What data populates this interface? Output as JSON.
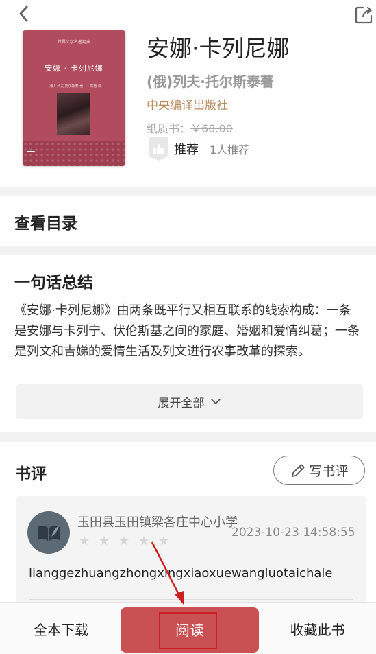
{
  "icons": {
    "back": "chevron-left-icon",
    "share": "share-icon",
    "recommend": "thumbs-up-icon",
    "expand": "chevron-down-icon",
    "write": "pencil-icon",
    "avatar": "book-leaf-icon"
  },
  "colors": {
    "accent": "#c95153",
    "publisher": "#b98c5f",
    "cover": "#b04c5d",
    "annotation": "#cc1f1f"
  },
  "book": {
    "cover": {
      "series": "世界文学名著经典",
      "title": "安娜 · 卡列尼娜",
      "author_line": "〔俄〕列夫·托尔斯泰 著　　高植 译"
    },
    "title": "安娜·卡列尼娜",
    "author": "(俄)列夫·托尔斯泰著",
    "publisher": "中央编译出版社",
    "price_label": "纸质书：",
    "price_value": "￥68.00",
    "recommend_label": "推荐",
    "recommend_count": "1人推荐"
  },
  "catalog": {
    "label": "查看目录"
  },
  "summary": {
    "title": "一句话总结",
    "text": "《安娜·卡列尼娜》由两条既平行又相互联系的线索构成：一条是安娜与卡列宁、伏伦斯基之间的家庭、婚姻和爱情纠葛；一条是列文和吉娣的爱情生活及列文进行农事改革的探索。",
    "expand_label": "展开全部"
  },
  "reviews": {
    "title": "书评",
    "write_label": "写书评",
    "items": [
      {
        "reviewer": "玉田县玉田镇梁各庄中心小学",
        "date": "2023-10-23 14:58:55",
        "rating": 0,
        "text": "lianggezhuangzhongxingxiaoxuewangluotaichale"
      }
    ]
  },
  "bottom_bar": {
    "download_label": "全本下载",
    "read_label": "阅读",
    "collect_label": "收藏此书"
  }
}
